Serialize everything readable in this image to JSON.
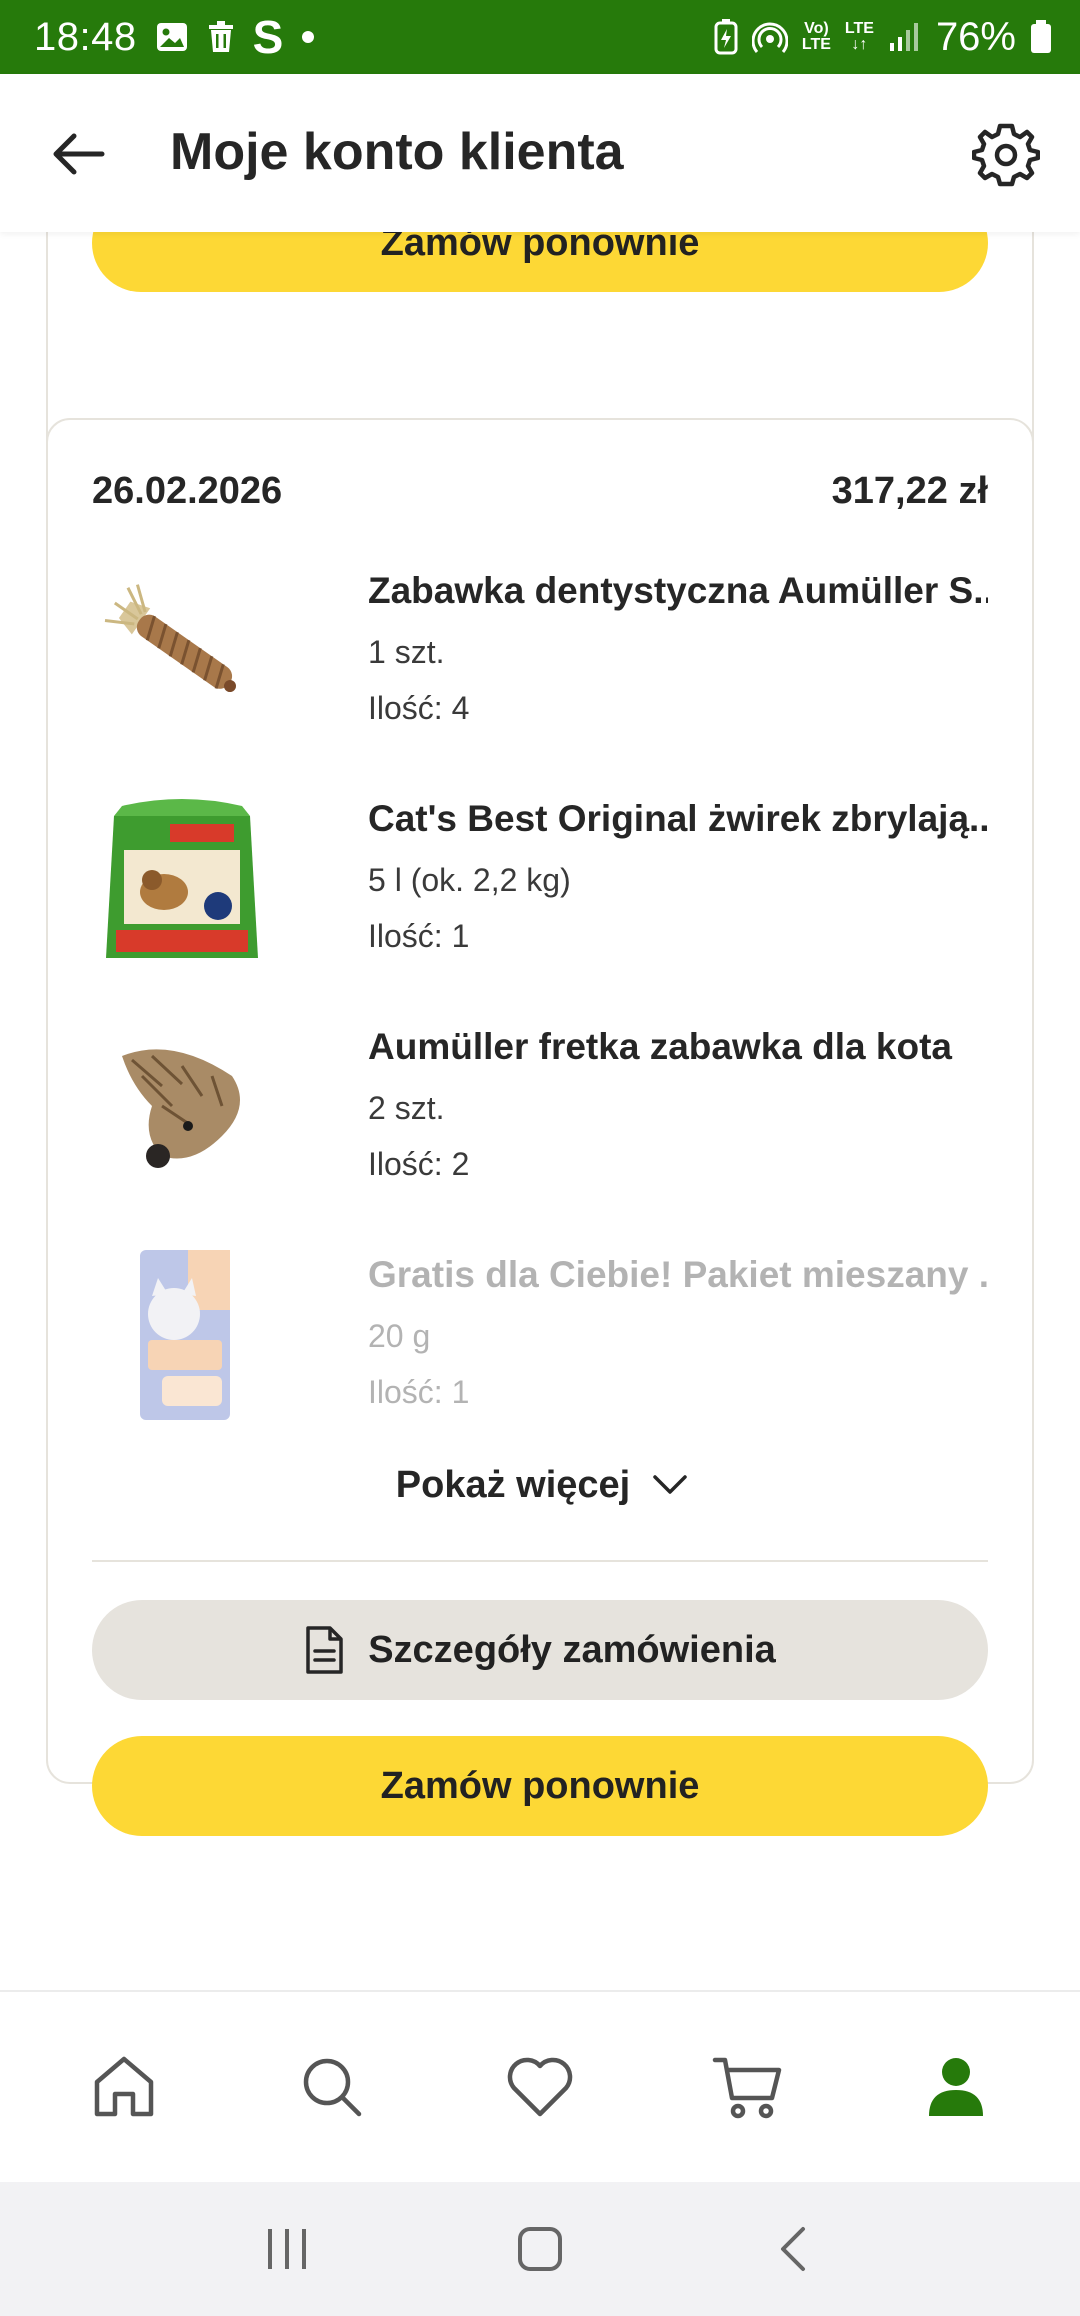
{
  "status_bar": {
    "time": "18:48",
    "battery": "76%",
    "net_top": "Vo)",
    "net_bottom": "LTE",
    "lte_top": "LTE",
    "icons": [
      "image-icon",
      "trash-icon",
      "s-app-icon",
      "dot-icon",
      "battery-saver-icon",
      "hotspot-icon",
      "volte-icon",
      "lte-icon",
      "signal-icon",
      "battery-icon"
    ]
  },
  "header": {
    "title": "Moje konto klienta",
    "back_icon": "arrow-left-icon",
    "settings_icon": "gear-icon"
  },
  "previous_order": {
    "reorder_label": "Zamów ponownie"
  },
  "order": {
    "date": "26.02.2026",
    "total": "317,22 zł",
    "items": [
      {
        "name": "Zabawka dentystyczna Aumüller S...",
        "variant": "1 szt.",
        "qty": "Ilość: 4",
        "thumb": "dental-chew-toy"
      },
      {
        "name": "Cat's Best Original żwirek zbrylają...",
        "variant": "5 l (ok. 2,2 kg)",
        "qty": "Ilość: 1",
        "thumb": "cat-litter-bag"
      },
      {
        "name": "Aumüller fretka zabawka dla kota",
        "variant": "2 szt.",
        "qty": "Ilość: 2",
        "thumb": "ferret-toy"
      },
      {
        "name": "Gratis dla Ciebie! Pakiet mieszany ...",
        "variant": "20 g",
        "qty": "Ilość: 1",
        "thumb": "treat-packet"
      }
    ],
    "show_more_label": "Pokaż więcej",
    "details_label": "Szczegóły zamówienia",
    "reorder_label": "Zamów ponownie"
  },
  "bottom_nav": {
    "items": [
      "home-icon",
      "search-icon",
      "heart-icon",
      "cart-icon",
      "account-icon"
    ],
    "active": "account-icon",
    "active_color": "#267a0b"
  },
  "colors": {
    "brand_green": "#267a0b",
    "accent_yellow": "#fdd835",
    "secondary_button": "#e6e3dd"
  }
}
